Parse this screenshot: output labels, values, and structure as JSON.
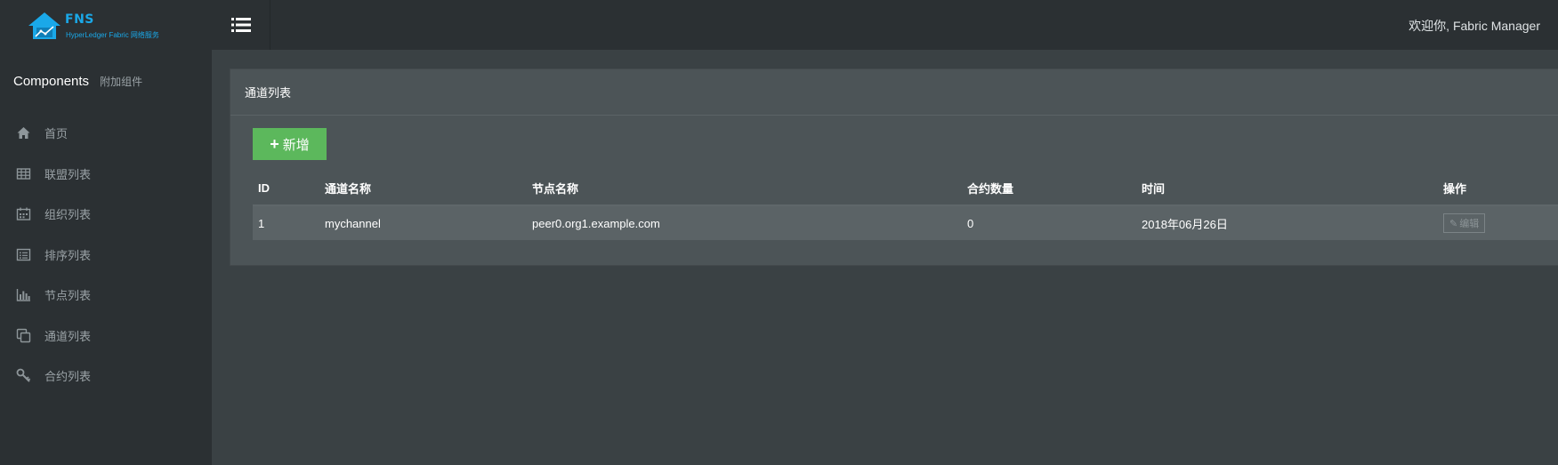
{
  "brand": {
    "name": "FNS",
    "subtitle": "HyperLedger Fabric 网络服务",
    "color": "#1aa8e8"
  },
  "sidebar": {
    "section_title": "Components",
    "section_sub": "附加组件",
    "items": [
      {
        "label": "首页",
        "icon": "home-icon"
      },
      {
        "label": "联盟列表",
        "icon": "table-icon"
      },
      {
        "label": "组织列表",
        "icon": "calendar-icon"
      },
      {
        "label": "排序列表",
        "icon": "list-alt-icon"
      },
      {
        "label": "节点列表",
        "icon": "bar-chart-icon"
      },
      {
        "label": "通道列表",
        "icon": "copy-icon"
      },
      {
        "label": "合约列表",
        "icon": "key-icon"
      }
    ]
  },
  "header": {
    "menu_icon": "list-icon",
    "welcome": "欢迎你, Fabric Manager"
  },
  "panel": {
    "title": "通道列表",
    "add_label": "新增",
    "add_color": "#5cb85c"
  },
  "table": {
    "columns": [
      "ID",
      "通道名称",
      "节点名称",
      "合约数量",
      "时间",
      "操作"
    ],
    "rows": [
      {
        "id": "1",
        "channel": "mychannel",
        "peer": "peer0.org1.example.com",
        "contracts": "0",
        "time": "2018年06月26日",
        "action": "编辑"
      }
    ]
  }
}
